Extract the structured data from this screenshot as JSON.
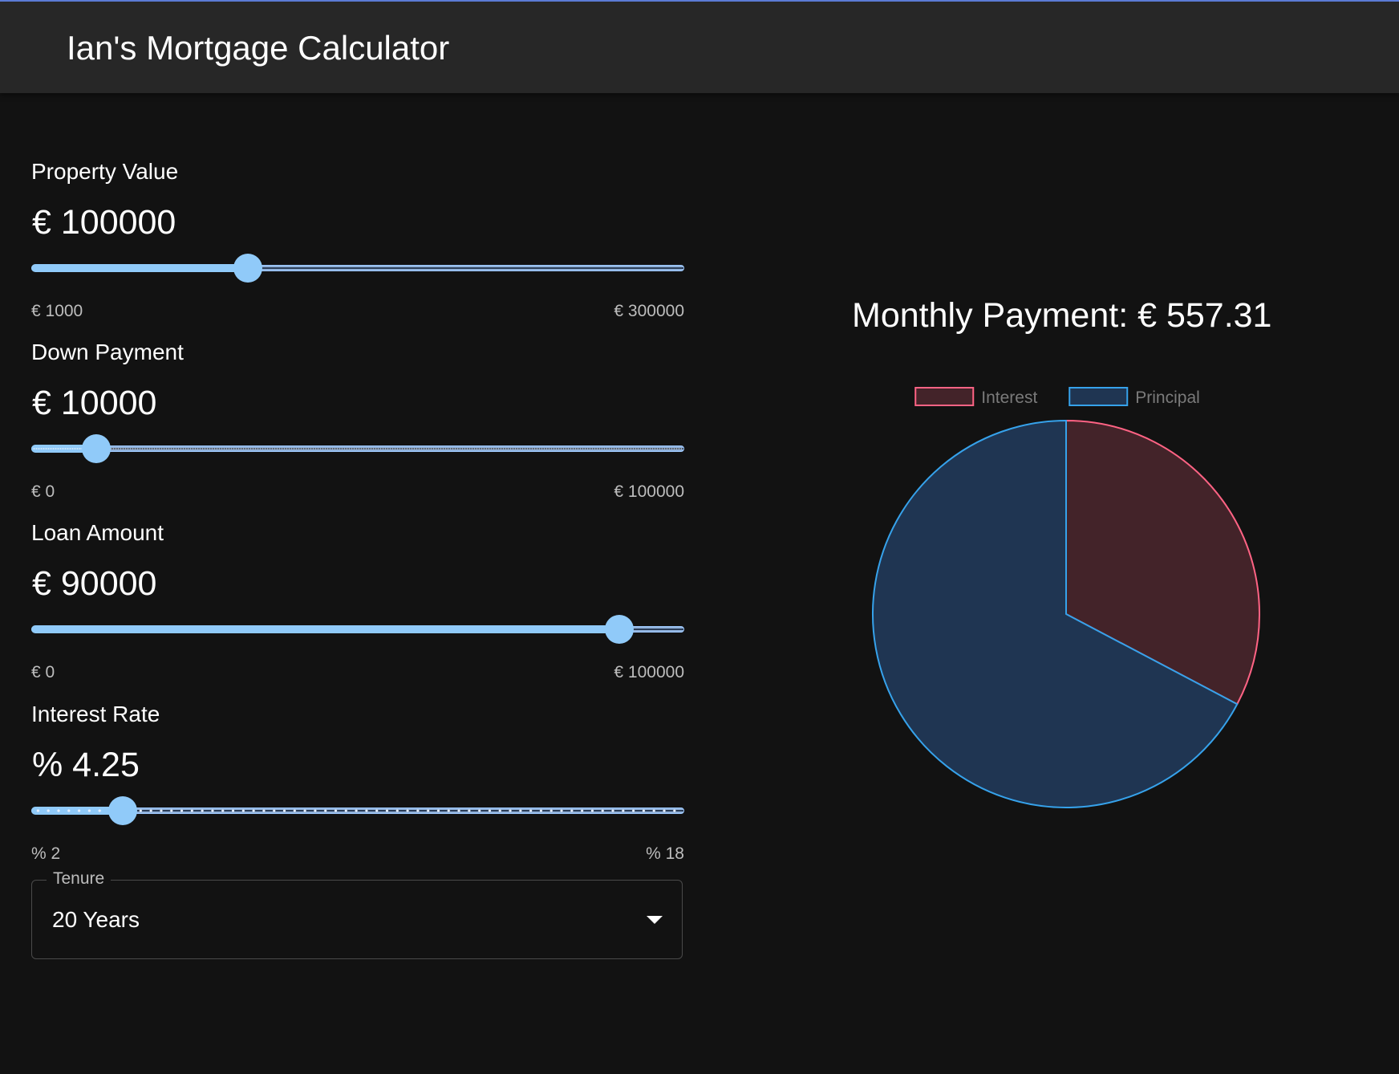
{
  "app": {
    "title": "Ian's Mortgage Calculator"
  },
  "sliders": [
    {
      "label": "Property Value",
      "value_text": "€ 100000",
      "min_label": "€ 1000",
      "max_label": "€ 300000",
      "min": 1000,
      "max": 300000,
      "value": 100000,
      "ticks": "none"
    },
    {
      "label": "Down Payment",
      "value_text": "€ 10000",
      "min_label": "€ 0",
      "max_label": "€ 100000",
      "min": 0,
      "max": 100000,
      "value": 10000,
      "ticks": "fine"
    },
    {
      "label": "Loan Amount",
      "value_text": "€ 90000",
      "min_label": "€ 0",
      "max_label": "€ 100000",
      "min": 0,
      "max": 100000,
      "value": 90000,
      "ticks": "none"
    },
    {
      "label": "Interest Rate",
      "value_text": "% 4.25",
      "min_label": "% 2",
      "max_label": "% 18",
      "min": 2,
      "max": 18,
      "value": 4.25,
      "ticks": "coarse"
    }
  ],
  "tenure": {
    "label": "Tenure",
    "value": "20 Years"
  },
  "summary": {
    "monthly_payment": "Monthly Payment: € 557.31"
  },
  "colors": {
    "accent": "#90caf9",
    "interest_border": "#ff6384",
    "interest_fill": "#432329",
    "principal_border": "#36a2eb",
    "principal_fill": "#1f3552"
  },
  "chart_data": {
    "type": "pie",
    "categories": [
      "Interest",
      "Principal"
    ],
    "values": [
      43753.44,
      90000
    ],
    "legend": "top"
  }
}
